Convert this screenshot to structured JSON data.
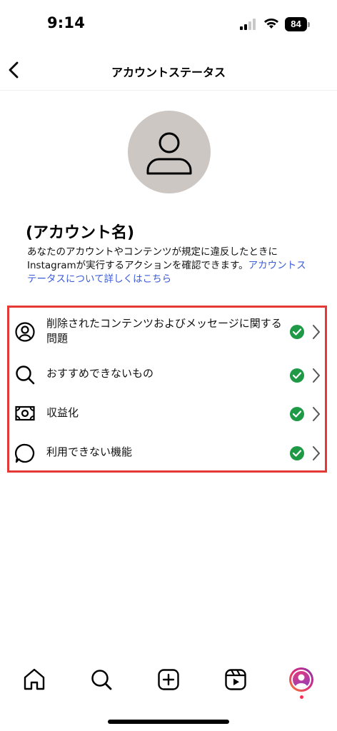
{
  "status_bar": {
    "time": "9:14",
    "battery": "84"
  },
  "header": {
    "title": "アカウントステータス"
  },
  "account": {
    "name": "(アカウント名)",
    "description_text": "あなたのアカウントやコンテンツが規定に違反したときにInstagramが実行するアクションを確認できます。",
    "description_link": "アカウントステータスについて詳しくはこちら"
  },
  "items": [
    {
      "label": "削除されたコンテンツおよびメッセージに関する問題",
      "icon": "person-circle-icon",
      "status": "ok"
    },
    {
      "label": "おすすめできないもの",
      "icon": "search-icon",
      "status": "ok"
    },
    {
      "label": "収益化",
      "icon": "money-icon",
      "status": "ok"
    },
    {
      "label": "利用できない機能",
      "icon": "chat-bubble-icon",
      "status": "ok"
    }
  ],
  "colors": {
    "check_green": "#1e9945",
    "link_blue": "#3a5bd9",
    "highlight_red": "#e53935"
  }
}
